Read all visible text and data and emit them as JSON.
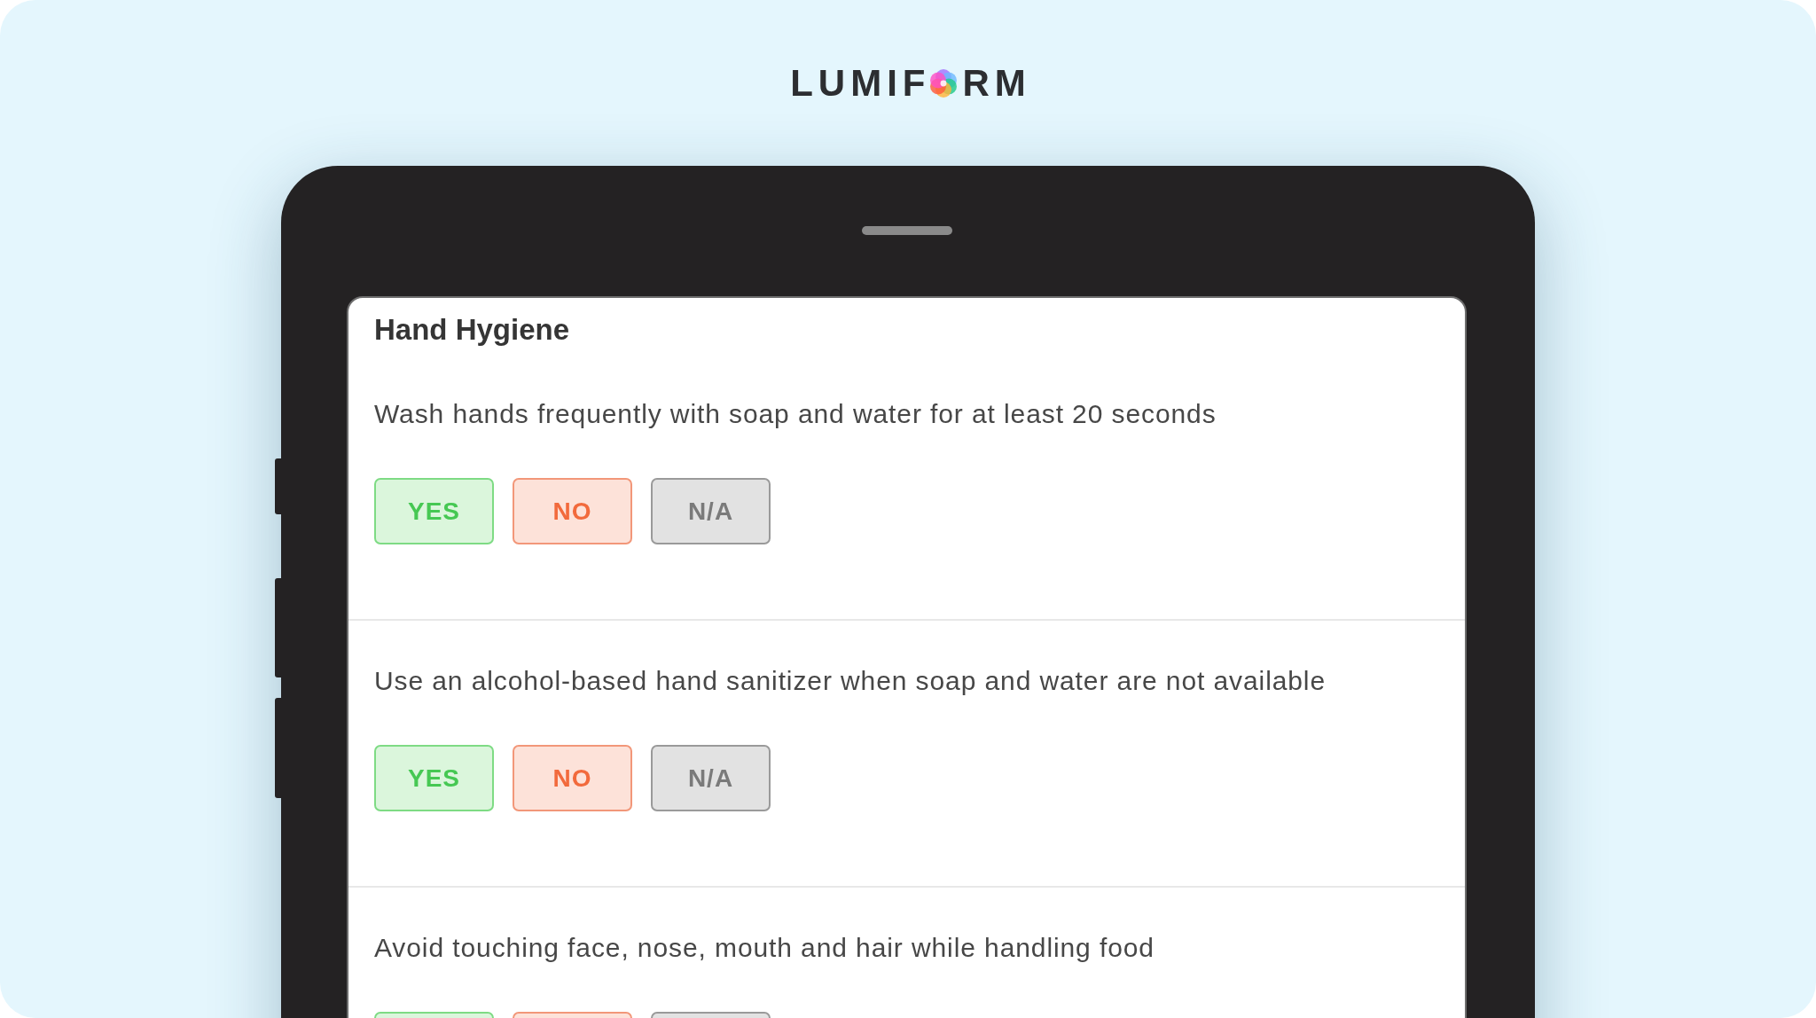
{
  "logo": {
    "lead": "LUMIF",
    "tail": "RM"
  },
  "form": {
    "title": "Hand Hygiene",
    "questions": [
      {
        "text": "Wash hands frequently with soap and water for at least 20 seconds",
        "options": [
          {
            "kind": "yes",
            "label": "YES",
            "selected": false
          },
          {
            "kind": "no",
            "label": "NO",
            "selected": false
          },
          {
            "kind": "na",
            "label": "N/A",
            "selected": false
          }
        ]
      },
      {
        "text": "Use an alcohol-based hand sanitizer when soap and water are not available",
        "options": [
          {
            "kind": "yes",
            "label": "YES",
            "selected": false
          },
          {
            "kind": "no",
            "label": "NO",
            "selected": false
          },
          {
            "kind": "na",
            "label": "N/A",
            "selected": false
          }
        ]
      },
      {
        "text": "Avoid touching face, nose, mouth and hair while handling food",
        "options": [
          {
            "kind": "yes",
            "selected": false
          },
          {
            "kind": "no",
            "selected": false
          },
          {
            "kind": "na",
            "selected": false
          }
        ]
      }
    ]
  }
}
